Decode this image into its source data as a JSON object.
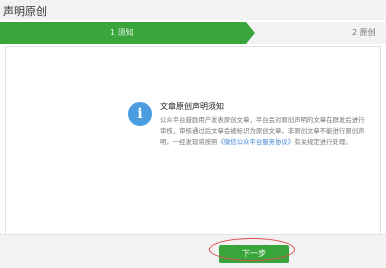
{
  "header": {
    "title": "声明原创"
  },
  "steps": [
    {
      "label": "1 须知",
      "active": true
    },
    {
      "label": "2 原创",
      "active": false
    }
  ],
  "colors": {
    "step_active": "#3aa53a",
    "info_icon": "#4b9be0",
    "link": "#3a7fd5",
    "annotation": "#d94a4a"
  },
  "notice": {
    "icon": "info-icon",
    "icon_glyph": "i",
    "title": "文章原创声明须知",
    "body_part1": "公众平台鼓励用户发表原创文章，平台会对原创声明的文章在群发后进行审核，审核通过后文章会被标识为原创文章。非原创文章不能进行原创声明，一经发现将按照",
    "link_text": "《微信公众平台服务协议》",
    "body_part2": "有关规定进行处理。"
  },
  "footer": {
    "next_label": "下一步"
  }
}
